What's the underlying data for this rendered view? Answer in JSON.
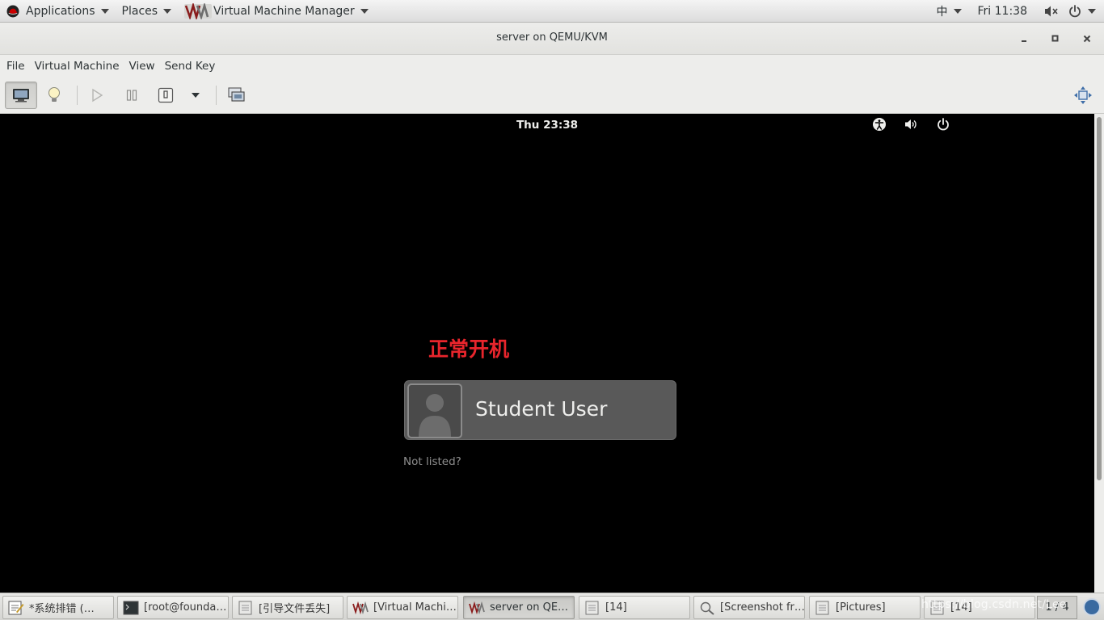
{
  "top_bar": {
    "applications_label": "Applications",
    "places_label": "Places",
    "active_app_label": "Virtual Machine Manager",
    "input_method": "中",
    "clock": "Fri 11:38",
    "icons": [
      "redhat-icon",
      "vmm-icon",
      "volume-icon",
      "power-icon"
    ]
  },
  "window": {
    "title": "server on QEMU/KVM",
    "controls": [
      "minimize-icon",
      "maximize-icon",
      "close-icon"
    ]
  },
  "menubar": {
    "items": [
      "File",
      "Virtual Machine",
      "View",
      "Send Key"
    ]
  },
  "toolbar": {
    "buttons": [
      "console-icon",
      "details-lightbulb-icon",
      "run-icon",
      "pause-icon",
      "shutdown-icon",
      "shutdown-menu-icon",
      "snapshots-icon",
      "fullscreen-icon"
    ]
  },
  "vm_screen": {
    "clock": "Thu 23:38",
    "annotation": "正常开机",
    "annotation_color": "#e8252c",
    "user_name": "Student User",
    "not_listed": "Not listed?",
    "icons": [
      "accessibility-icon",
      "volume-icon",
      "power-icon"
    ]
  },
  "taskbar": {
    "tasks": [
      {
        "label": "*系统排错 (…",
        "icon": "text-editor-icon"
      },
      {
        "label": "[root@founda…",
        "icon": "terminal-icon"
      },
      {
        "label": "[引导文件丢失]",
        "icon": "window-icon"
      },
      {
        "label": "[Virtual Machi…",
        "icon": "vmm-icon"
      },
      {
        "label": "server on QE…",
        "icon": "vmm-icon"
      },
      {
        "label": "[14]",
        "icon": "window-icon"
      },
      {
        "label": "[Screenshot fr…",
        "icon": "screenshot-icon"
      },
      {
        "label": "[Pictures]",
        "icon": "window-icon"
      },
      {
        "label": "[14]",
        "icon": "window-icon"
      }
    ],
    "watermark": "https://blog.csdn.net/Lee",
    "pager": "1 / 4"
  }
}
